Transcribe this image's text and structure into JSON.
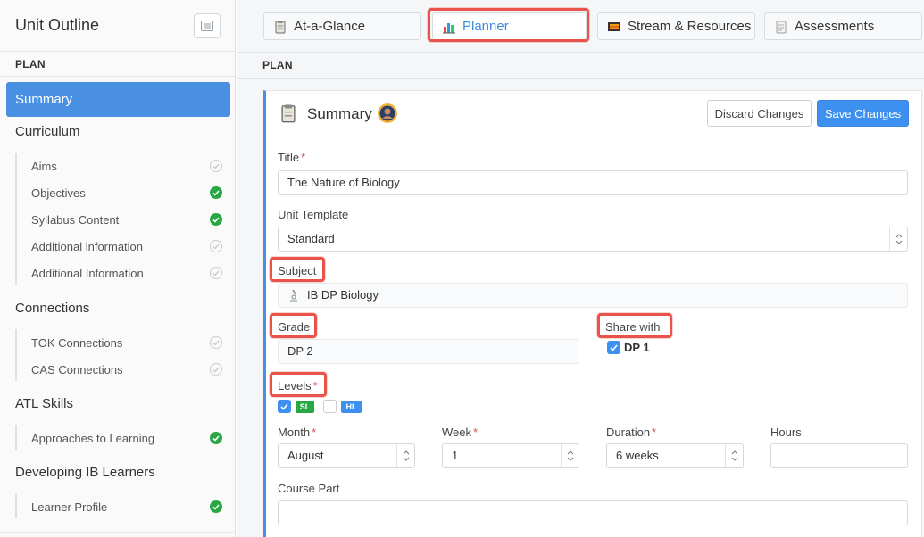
{
  "sidebar": {
    "title": "Unit Outline",
    "plan_label": "PLAN",
    "active_item": "Summary",
    "sections": [
      {
        "title": "Curriculum",
        "items": [
          {
            "label": "Aims",
            "done": false
          },
          {
            "label": "Objectives",
            "done": true
          },
          {
            "label": "Syllabus Content",
            "done": true
          },
          {
            "label": "Additional information",
            "done": false
          },
          {
            "label": "Additional Information",
            "done": false
          }
        ]
      },
      {
        "title": "Connections",
        "items": [
          {
            "label": "TOK Connections",
            "done": false
          },
          {
            "label": "CAS Connections",
            "done": false
          }
        ]
      },
      {
        "title": "ATL Skills",
        "items": [
          {
            "label": "Approaches to Learning",
            "done": true
          }
        ]
      },
      {
        "title": "Developing IB Learners",
        "items": [
          {
            "label": "Learner Profile",
            "done": true
          }
        ]
      }
    ]
  },
  "tabs": [
    {
      "label": "At-a-Glance",
      "icon": "clipboard-icon"
    },
    {
      "label": "Planner",
      "icon": "bar-chart-icon"
    },
    {
      "label": "Stream & Resources",
      "icon": "film-icon"
    },
    {
      "label": "Assessments",
      "icon": "notepad-icon"
    }
  ],
  "main": {
    "plan_label": "PLAN",
    "card_title": "Summary",
    "discard_label": "Discard Changes",
    "save_label": "Save Changes"
  },
  "form": {
    "title_label": "Title",
    "title_value": "The Nature of Biology",
    "template_label": "Unit Template",
    "template_value": "Standard",
    "subject_label": "Subject",
    "subject_value": "IB DP Biology",
    "grade_label": "Grade",
    "grade_value": "DP 2",
    "share_label": "Share with",
    "share_value": "DP 1",
    "levels_label": "Levels",
    "level_sl": "SL",
    "level_hl": "HL",
    "month_label": "Month",
    "month_value": "August",
    "week_label": "Week",
    "week_value": "1",
    "duration_label": "Duration",
    "duration_value": "6 weeks",
    "hours_label": "Hours",
    "hours_value": "",
    "course_part_label": "Course Part",
    "course_part_value": ""
  },
  "colors": {
    "accent": "#3d8ff0",
    "highlight": "#e8534a",
    "done": "#28a745",
    "sl_badge": "#28a745",
    "hl_badge": "#3d8ff0"
  }
}
